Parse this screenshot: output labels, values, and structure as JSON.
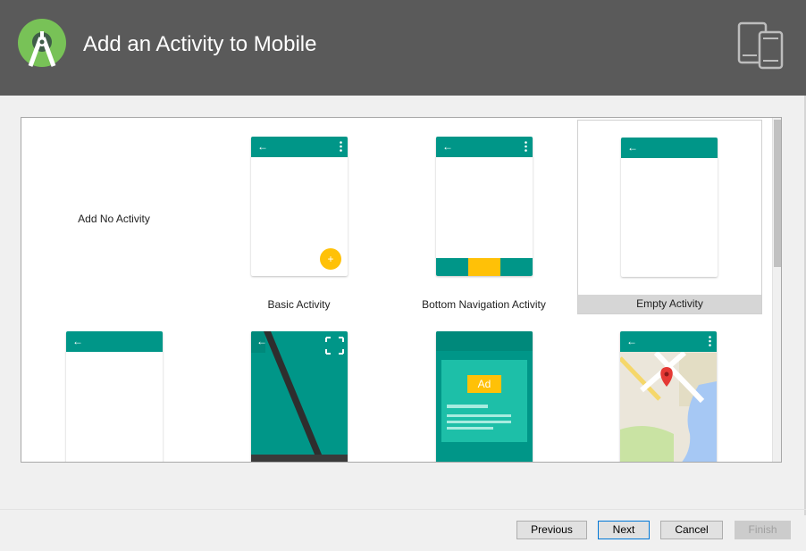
{
  "window": {
    "title": "Add an Activity to Mobile"
  },
  "colors": {
    "header": "#5a5a5a",
    "teal": "#009688",
    "amber": "#ffc107",
    "android_green": "#78c257"
  },
  "gallery": {
    "tiles": [
      {
        "label": "Add No Activity"
      },
      {
        "label": "Basic Activity"
      },
      {
        "label": "Bottom Navigation Activity"
      },
      {
        "label": "Empty Activity",
        "selected": true
      }
    ],
    "ad_label": "Ad"
  },
  "buttons": {
    "previous": "Previous",
    "next": "Next",
    "cancel": "Cancel",
    "finish": "Finish"
  }
}
